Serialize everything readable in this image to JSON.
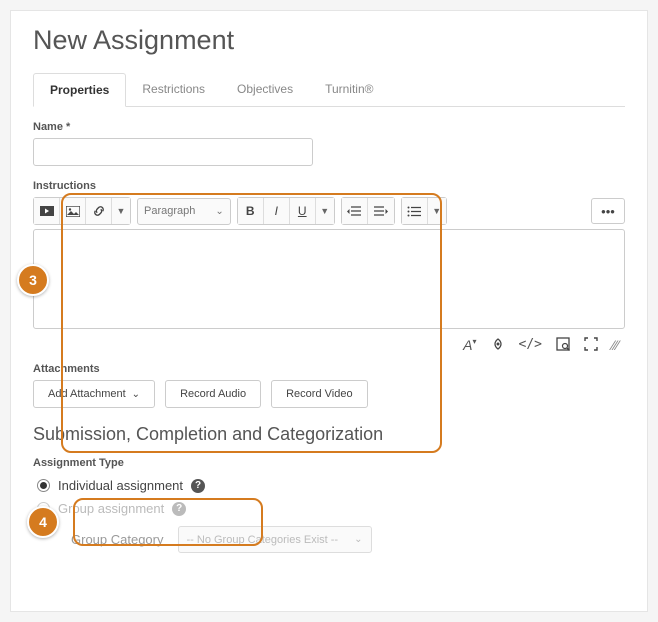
{
  "page_title": "New Assignment",
  "tabs": [
    "Properties",
    "Restrictions",
    "Objectives",
    "Turnitin®"
  ],
  "active_tab": 0,
  "name": {
    "label": "Name *",
    "value": ""
  },
  "instructions": {
    "label": "Instructions",
    "paragraph_style": "Paragraph"
  },
  "attachments": {
    "label": "Attachments",
    "add_label": "Add Attachment",
    "record_audio": "Record Audio",
    "record_video": "Record Video"
  },
  "section_heading": "Submission, Completion and Categorization",
  "assignment_type": {
    "label": "Assignment Type",
    "individual": "Individual assignment",
    "group": "Group assignment",
    "selected": "individual",
    "group_category_label": "Group Category",
    "group_category_placeholder": "-- No Group Categories Exist --"
  },
  "callouts": {
    "three": "3",
    "four": "4"
  }
}
